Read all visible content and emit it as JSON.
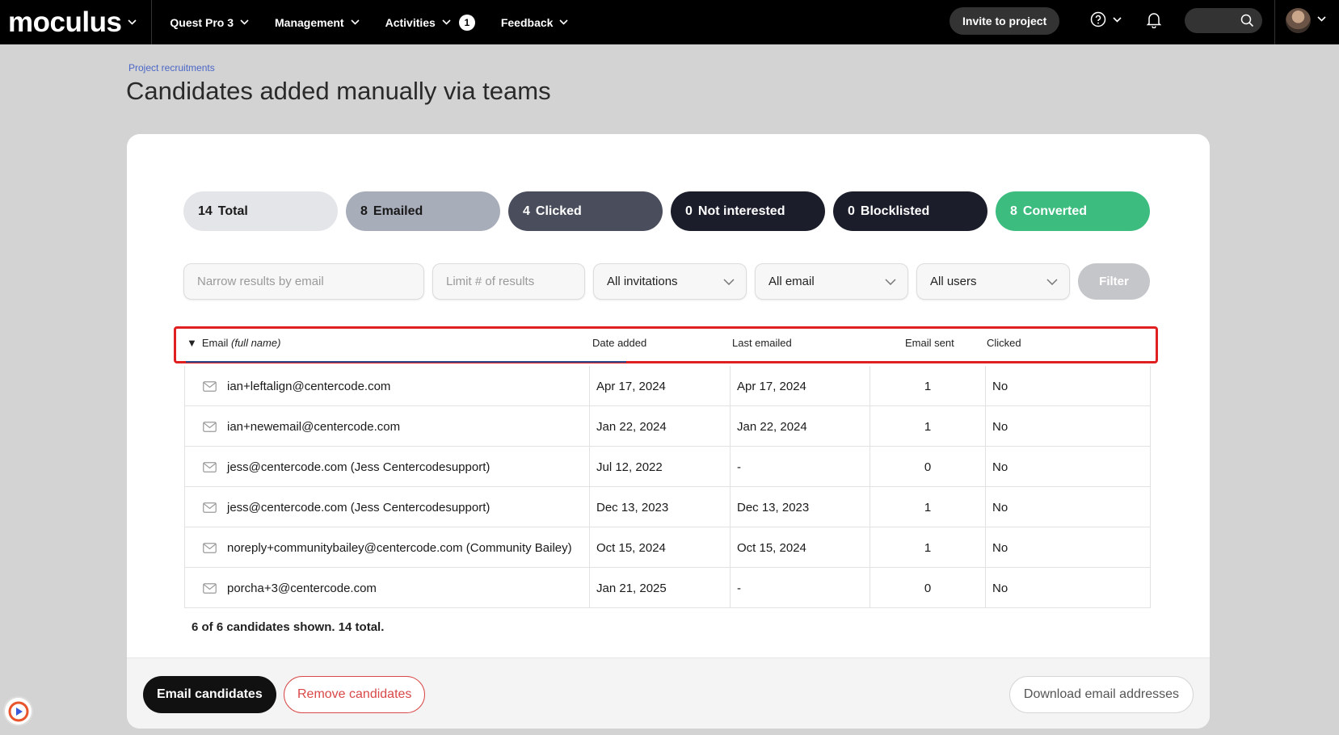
{
  "colors": {
    "nav_bg": "#000000",
    "page_bg": "#d3d3d3",
    "breadcrumb": "#4a66c7",
    "highlight_border": "#e02020",
    "remove_red": "#d94848"
  },
  "nav": {
    "logo": "moculus",
    "items": [
      {
        "label": "Quest Pro 3"
      },
      {
        "label": "Management"
      },
      {
        "label": "Activities",
        "badge": "1"
      },
      {
        "label": "Feedback"
      }
    ],
    "invite_label": "Invite to project",
    "icons": [
      "help-icon",
      "bell-icon",
      "search-icon",
      "avatar"
    ]
  },
  "breadcrumb": "Project recruitments",
  "page_title": "Candidates added manually via teams",
  "stats": [
    {
      "count": "14",
      "label": "Total",
      "bg": "#e4e5e9",
      "fg": "#1a1a1a"
    },
    {
      "count": "8",
      "label": "Emailed",
      "bg": "#a8adba",
      "fg": "#1a1a1a"
    },
    {
      "count": "4",
      "label": "Clicked",
      "bg": "#4a4d5c",
      "fg": "#ffffff"
    },
    {
      "count": "0",
      "label": "Not interested",
      "bg": "#1b1d2b",
      "fg": "#ffffff"
    },
    {
      "count": "0",
      "label": "Blocklisted",
      "bg": "#1b1d2b",
      "fg": "#ffffff"
    },
    {
      "count": "8",
      "label": "Converted",
      "bg": "#3cbd7f",
      "fg": "#ffffff"
    }
  ],
  "filters": {
    "email_placeholder": "Narrow results by email",
    "limit_placeholder": "Limit # of results",
    "invitations_value": "All invitations",
    "email_value": "All email",
    "users_value": "All users",
    "filter_label": "Filter"
  },
  "table": {
    "sort_indicator": "▼",
    "columns": {
      "email": "Email",
      "email_sub": "(full name)",
      "date_added": "Date added",
      "last_emailed": "Last emailed",
      "email_sent": "Email sent",
      "clicked": "Clicked"
    },
    "rows": [
      {
        "email": "ian+leftalign@centercode.com",
        "date_added": "Apr 17, 2024",
        "last_emailed": "Apr 17, 2024",
        "email_sent": "1",
        "clicked": "No"
      },
      {
        "email": "ian+newemail@centercode.com",
        "date_added": "Jan 22, 2024",
        "last_emailed": "Jan 22, 2024",
        "email_sent": "1",
        "clicked": "No"
      },
      {
        "email": "jess@centercode.com (Jess Centercodesupport)",
        "date_added": "Jul 12, 2022",
        "last_emailed": "-",
        "email_sent": "0",
        "clicked": "No"
      },
      {
        "email": "jess@centercode.com (Jess Centercodesupport)",
        "date_added": "Dec 13, 2023",
        "last_emailed": "Dec 13, 2023",
        "email_sent": "1",
        "clicked": "No"
      },
      {
        "email": "noreply+communitybailey@centercode.com (Community Bailey)",
        "date_added": "Oct 15, 2024",
        "last_emailed": "Oct 15, 2024",
        "email_sent": "1",
        "clicked": "No"
      },
      {
        "email": "porcha+3@centercode.com",
        "date_added": "Jan 21, 2025",
        "last_emailed": "-",
        "email_sent": "0",
        "clicked": "No"
      }
    ]
  },
  "summary": "6 of 6 candidates shown. 14 total.",
  "actions": {
    "email_candidates": "Email candidates",
    "remove_candidates": "Remove candidates",
    "download_emails": "Download email addresses"
  }
}
